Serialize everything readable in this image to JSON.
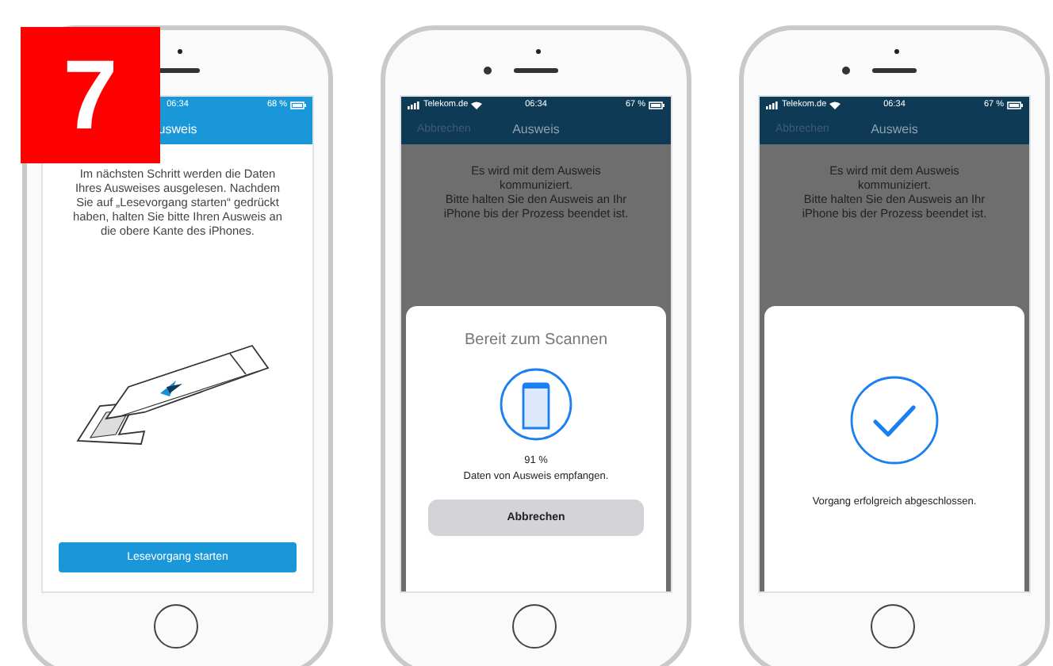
{
  "badge": {
    "text": "7"
  },
  "phones": [
    {
      "kind": "intro",
      "status_bar": {
        "time": "06:34",
        "battery": "68 %"
      },
      "nav": {
        "title": "usweis"
      },
      "instructions": "Im nächsten Schritt werden die Daten Ihres Ausweises ausgelesen. Nachdem Sie auf „Lesevorgang starten“ gedrückt haben, halten Sie bitte Ihren Ausweis an die obere Kante des iPhones.",
      "button": "Lesevorgang starten"
    },
    {
      "kind": "scanning",
      "status_bar": {
        "carrier": "Telekom.de",
        "time": "06:34",
        "battery": "67 %"
      },
      "nav": {
        "cancel": "Abbrechen",
        "title": "Ausweis"
      },
      "message": [
        "Es wird mit dem Ausweis kommuniziert.",
        "Bitte halten Sie den Ausweis an Ihr iPhone bis der Prozess beendet ist."
      ],
      "sheet": {
        "title": "Bereit zum Scannen",
        "progress": "91 %",
        "status": "Daten von Ausweis empfangen.",
        "button": "Abbrechen"
      }
    },
    {
      "kind": "done",
      "status_bar": {
        "carrier": "Telekom.de",
        "time": "06:34",
        "battery": "67 %"
      },
      "nav": {
        "cancel": "Abbrechen",
        "title": "Ausweis"
      },
      "message": [
        "Es wird mit dem Ausweis kommuniziert.",
        "Bitte halten Sie den Ausweis an Ihr iPhone bis der Prozess beendet ist."
      ],
      "sheet": {
        "status": "Vorgang erfolgreich abgeschlossen."
      }
    }
  ]
}
